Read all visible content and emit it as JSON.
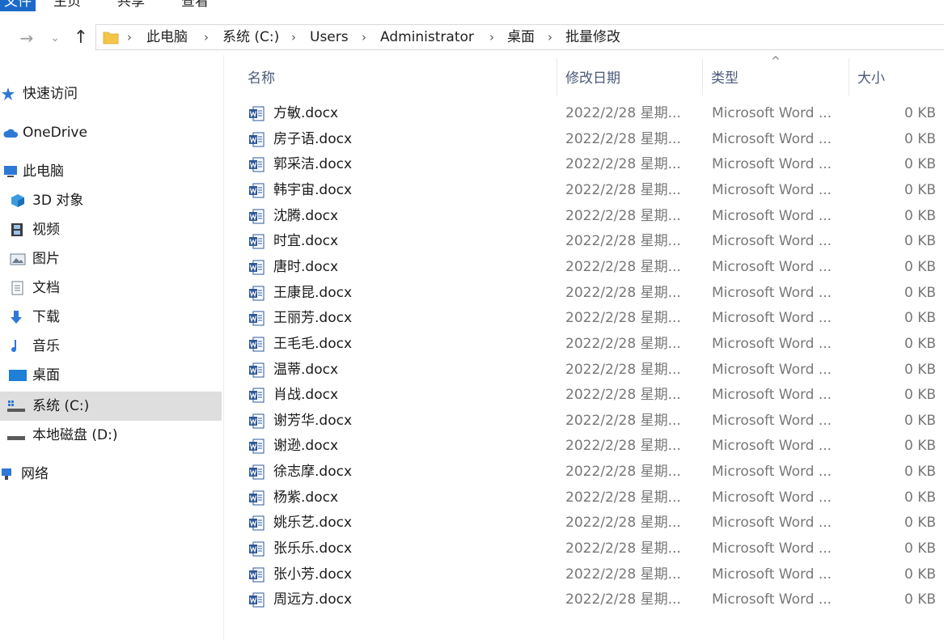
{
  "ribbon": {
    "file_tab": "文件",
    "tabs": [
      "主页",
      "共享",
      "查看"
    ]
  },
  "nav_buttons": {
    "back": "←",
    "forward": "→",
    "recent": "⌄",
    "up": "↑"
  },
  "breadcrumb": [
    "此电脑",
    "系统 (C:)",
    "Users",
    "Administrator",
    "桌面",
    "批量修改"
  ],
  "breadcrumb_separator": "›",
  "nav_pane": {
    "items": [
      {
        "label": "快速访问",
        "icon": "star-icon"
      },
      {
        "label": "OneDrive",
        "icon": "cloud-icon"
      },
      {
        "label": "此电脑",
        "icon": "computer-icon"
      },
      {
        "label": "3D 对象",
        "icon": "cube-icon"
      },
      {
        "label": "视频",
        "icon": "video-icon"
      },
      {
        "label": "图片",
        "icon": "picture-icon"
      },
      {
        "label": "文档",
        "icon": "document-icon"
      },
      {
        "label": "下载",
        "icon": "download-icon"
      },
      {
        "label": "音乐",
        "icon": "music-icon"
      },
      {
        "label": "桌面",
        "icon": "desktop-icon"
      },
      {
        "label": "系统 (C:)",
        "icon": "system-drive-icon",
        "selected": true
      },
      {
        "label": "本地磁盘 (D:)",
        "icon": "drive-icon"
      },
      {
        "label": "网络",
        "icon": "network-icon"
      }
    ]
  },
  "columns": {
    "name": "名称",
    "date": "修改日期",
    "type": "类型",
    "size": "大小",
    "sort_indicator": "^"
  },
  "files": [
    {
      "name": "方敏.docx",
      "date": "2022/2/28 星期...",
      "type": "Microsoft Word ...",
      "size": "0 KB"
    },
    {
      "name": "房子语.docx",
      "date": "2022/2/28 星期...",
      "type": "Microsoft Word ...",
      "size": "0 KB"
    },
    {
      "name": "郭采洁.docx",
      "date": "2022/2/28 星期...",
      "type": "Microsoft Word ...",
      "size": "0 KB"
    },
    {
      "name": "韩宇宙.docx",
      "date": "2022/2/28 星期...",
      "type": "Microsoft Word ...",
      "size": "0 KB"
    },
    {
      "name": "沈腾.docx",
      "date": "2022/2/28 星期...",
      "type": "Microsoft Word ...",
      "size": "0 KB"
    },
    {
      "name": "时宜.docx",
      "date": "2022/2/28 星期...",
      "type": "Microsoft Word ...",
      "size": "0 KB"
    },
    {
      "name": "唐时.docx",
      "date": "2022/2/28 星期...",
      "type": "Microsoft Word ...",
      "size": "0 KB"
    },
    {
      "name": "王康昆.docx",
      "date": "2022/2/28 星期...",
      "type": "Microsoft Word ...",
      "size": "0 KB"
    },
    {
      "name": "王丽芳.docx",
      "date": "2022/2/28 星期...",
      "type": "Microsoft Word ...",
      "size": "0 KB"
    },
    {
      "name": "王毛毛.docx",
      "date": "2022/2/28 星期...",
      "type": "Microsoft Word ...",
      "size": "0 KB"
    },
    {
      "name": "温蒂.docx",
      "date": "2022/2/28 星期...",
      "type": "Microsoft Word ...",
      "size": "0 KB"
    },
    {
      "name": "肖战.docx",
      "date": "2022/2/28 星期...",
      "type": "Microsoft Word ...",
      "size": "0 KB"
    },
    {
      "name": "谢芳华.docx",
      "date": "2022/2/28 星期...",
      "type": "Microsoft Word ...",
      "size": "0 KB"
    },
    {
      "name": "谢逊.docx",
      "date": "2022/2/28 星期...",
      "type": "Microsoft Word ...",
      "size": "0 KB"
    },
    {
      "name": "徐志摩.docx",
      "date": "2022/2/28 星期...",
      "type": "Microsoft Word ...",
      "size": "0 KB"
    },
    {
      "name": "杨紫.docx",
      "date": "2022/2/28 星期...",
      "type": "Microsoft Word ...",
      "size": "0 KB"
    },
    {
      "name": "姚乐艺.docx",
      "date": "2022/2/28 星期...",
      "type": "Microsoft Word ...",
      "size": "0 KB"
    },
    {
      "name": "张乐乐.docx",
      "date": "2022/2/28 星期...",
      "type": "Microsoft Word ...",
      "size": "0 KB"
    },
    {
      "name": "张小芳.docx",
      "date": "2022/2/28 星期...",
      "type": "Microsoft Word ...",
      "size": "0 KB"
    },
    {
      "name": "周远方.docx",
      "date": "2022/2/28 星期...",
      "type": "Microsoft Word ...",
      "size": "0 KB"
    }
  ],
  "colors": {
    "accent": "#1b6ac9",
    "selected_bg": "#dedede",
    "header_text": "#4a5a7a",
    "meta_text": "#777777"
  }
}
